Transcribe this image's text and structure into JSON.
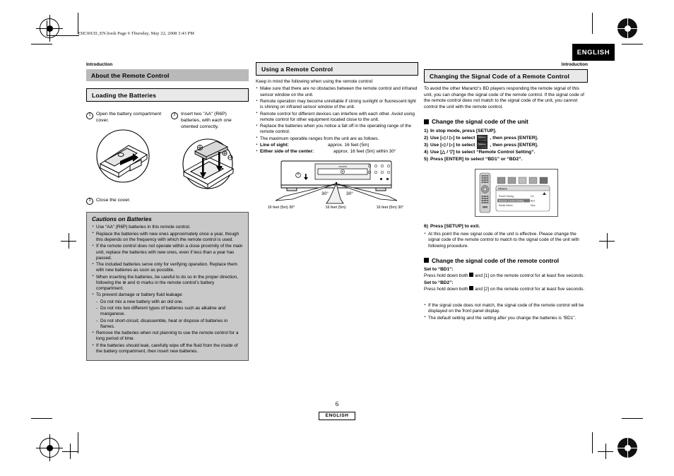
{
  "document": {
    "book_line": "ESE30UD_EN.book  Page 6  Thursday, May 22, 2008  3:43 PM",
    "language_tab": "ENGLISH",
    "page_number": "6",
    "page_language": "ENGLISH"
  },
  "left_column": {
    "eyebrow": "Introduction",
    "section_bar": "About the Remote Control",
    "subsection_bar": "Loading the Batteries",
    "steps": [
      {
        "number": "1",
        "text": "Open the battery compartment cover."
      },
      {
        "number": "2",
        "text": "Insert two \"AA\" (R6P) batteries, with each one oriented correctly."
      },
      {
        "number": "3",
        "text": "Close the cover."
      }
    ],
    "cautions": {
      "title": "Cautions on Batteries",
      "items": [
        {
          "type": "bullet",
          "text": "Use “AA” (R6P) batteries in this remote control."
        },
        {
          "type": "bullet",
          "text": "Replace the batteries with new ones approximately once a year, though this depends on the frequency with which the remote control is used."
        },
        {
          "type": "bullet",
          "text": "If the remote control does not operate within a close proximity of the main unit, replace the batteries with new ones, even if less than a year has passed."
        },
        {
          "type": "bullet",
          "text": "The included batteries serve only for verifying operation. Replace them with new batteries as soon as possible."
        },
        {
          "type": "bullet",
          "text": "When inserting the batteries, be careful to do so in the proper direction, following the ⊕ and ⊖ marks in the remote control’s battery compartment."
        },
        {
          "type": "bullet",
          "text": "To prevent damage or battery fluid leakage:"
        },
        {
          "type": "dash",
          "text": "Do not mix a new battery with an old one."
        },
        {
          "type": "dash",
          "text": "Do not mix two different types of batteries such as alkaline and manganese."
        },
        {
          "type": "dash",
          "text": "Do not short-circuit, disassemble, heat or dispose of batteries in flames."
        },
        {
          "type": "bullet",
          "text": "Remove the batteries when not planning to use the remote control for a long period of time."
        },
        {
          "type": "bullet",
          "text": "If the batteries should leak, carefully wipe off the fluid from the inside of the battery compartment, then insert new batteries."
        }
      ]
    }
  },
  "middle_column": {
    "section_bar": "Using a Remote Control",
    "intro": "Keep in mind the following when using the remote control:",
    "bullets": [
      "Make sure that there are no obstacles between the remote control and infrared sensor window on the unit.",
      "Remote operation may become unreliable if strong sunlight or fluorescent light is shining on infrared sensor window of the unit.",
      "Remote control for different devices can interfere with each other. Avoid using remote control for other equipment located close to the unit.",
      "Replace the batteries when you notice a fall off in the operating range of the remote control.",
      "The maximum operable ranges from the unit are as follows."
    ],
    "ranges": [
      {
        "label": "Line of sight:",
        "value": "approx. 16 feet (5m)"
      },
      {
        "label": "Either side of the center:",
        "value": "approx. 16 feet (5m) within 30°"
      }
    ],
    "diagram": {
      "angle_left": "30°",
      "angle_right": "30°",
      "caption_left": "16 feet (5m) 30°",
      "caption_center": "16 feet (5m)",
      "caption_right": "16 feet (5m) 30°",
      "brand": "marantz"
    }
  },
  "right_column": {
    "eyebrow": "Introduction",
    "section_bar": "Changing the Signal Code of a Remote Control",
    "intro": "To avoid the other Marantz’s BD players responding the remote signal of this unit, you can change the signal code of the remote control. If the signal code of the remote control does not match to the signal code of the unit, you cannot control the unit with the remote control.",
    "unit_heading": "Change the signal code of the unit",
    "unit_steps": [
      {
        "num": "1)",
        "before": "In stop mode, press [SETUP].",
        "icon": false,
        "after": ""
      },
      {
        "num": "2)",
        "before": "Use [◁ / ▷] to select",
        "icon": true,
        "after": ", then press [ENTER]."
      },
      {
        "num": "3)",
        "before": "Use [◁ / ▷] to select",
        "icon": true,
        "after": ", then press [ENTER]."
      },
      {
        "num": "4)",
        "before": "Use [△ / ▽] to select “Remote Control Setting”.",
        "icon": false,
        "after": ""
      },
      {
        "num": "5)",
        "before": "Press [ENTER] to select “BD1” or “BD2”.",
        "icon": false,
        "after": ""
      }
    ],
    "osd": {
      "title": "Others",
      "rows": [
        {
          "label": "Preset Saving",
          "value": "On",
          "highlighted": false
        },
        {
          "label": "Remote Control Setting",
          "value": "BD1",
          "highlighted": true
        },
        {
          "label": "Media Select",
          "value": "Disc",
          "highlighted": false
        }
      ]
    },
    "step6": {
      "num": "6)",
      "text": "Press [SETUP] to exit."
    },
    "step6_note": "At this point the new signal code of the unit is effective. Please change the signal code of the remote control to match to the signal code of the unit with following procedure.",
    "remote_heading": "Change the signal code of the remote control",
    "bd1_label": "Set to “BD1”:",
    "bd1_before": "Press hold down both",
    "bd1_after": "and [1] on the remote control for at least five seconds.",
    "bd2_label": "Set to “BD2”:",
    "bd2_before": "Press hold down both",
    "bd2_after": "and [2] on the remote control for at least five seconds.",
    "notes": [
      "If the signal code does not match, the signal code of the remote control will be displayed on the front panel display.",
      "The default setting and the setting after you change the batteries is “BD1”."
    ]
  }
}
